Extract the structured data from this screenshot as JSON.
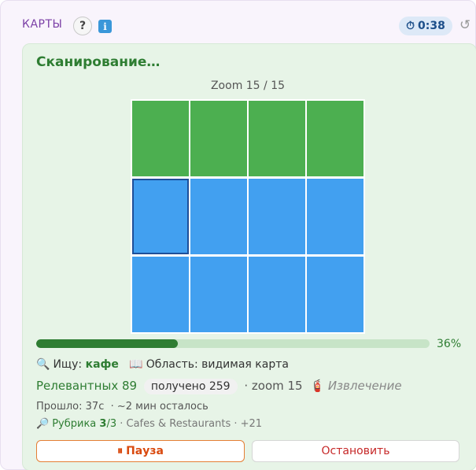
{
  "header": {
    "title": "КАРТЫ",
    "help_label": "?",
    "info_label": "i",
    "timer_icon": "⏱",
    "timer": "0:38",
    "refresh_icon": "↺"
  },
  "scan": {
    "title": "Сканирование…",
    "zoom_label": "Zoom 15 / 15",
    "grid": {
      "rows": 3,
      "cols": 4,
      "done_tiles": 4,
      "current_tile": 5,
      "done_color": "#4caf50",
      "pending_color": "#42a0f0"
    },
    "progress_fraction": 0.36,
    "progress_label": "36%"
  },
  "status": {
    "search_icon": "🔍",
    "search_prefix": "Ищу:",
    "search_keyword": "кафе",
    "area_icon": "📖",
    "area_text": "Область: видимая карта",
    "relevant": "Релевантных 89",
    "received": "получено 259",
    "zoom_info": "· zoom 15",
    "extract_icon": "🧯",
    "extract_text": "Извлечение",
    "elapsed": "Прошло: 37с",
    "remaining": "· ~2 мин осталось",
    "rubric_icon": "🔎",
    "rubric_prefix": "Рубрика",
    "rubric_current": "3",
    "rubric_total": "/3",
    "rubric_name": "· Cafes & Restaurants · +21"
  },
  "buttons": {
    "pause_icon": "⏸",
    "pause_label": "Пауза",
    "stop_label": "Остановить"
  }
}
